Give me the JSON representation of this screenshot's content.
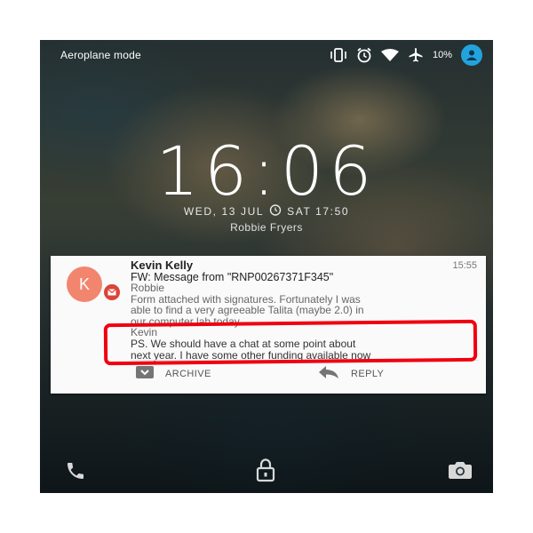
{
  "status_bar": {
    "mode_label": "Aeroplane mode",
    "battery_level": "10%",
    "icons": [
      "vibrate-icon",
      "alarm-icon",
      "wifi-icon",
      "airplane-icon",
      "user-avatar-icon"
    ]
  },
  "lock_screen": {
    "time": "16:06",
    "date": "WED, 13 JUL",
    "next_alarm": "SAT 17:50",
    "owner_name": "Robbie Fryers"
  },
  "notification": {
    "avatar_letter": "K",
    "sender": "Kevin Kelly",
    "time": "15:55",
    "subject": "FW: Message from \"RNP00267371F345\"",
    "body_lines": [
      "Robbie",
      "Form attached with signatures. Fortunately I was",
      "able to find a very agreeable Talita (maybe 2.0) in",
      "our computer lab today.....",
      "Kevin",
      "PS. We should have a chat at some point about",
      "next year. I have some other funding available now"
    ],
    "actions": {
      "archive": "ARCHIVE",
      "reply": "REPLY"
    },
    "accent_colors": {
      "avatar": "#f2856e",
      "gmail_badge": "#db4437",
      "highlight": "#f00010"
    }
  },
  "bottom_shortcuts": [
    "phone-icon",
    "unlock-icon",
    "camera-icon"
  ]
}
